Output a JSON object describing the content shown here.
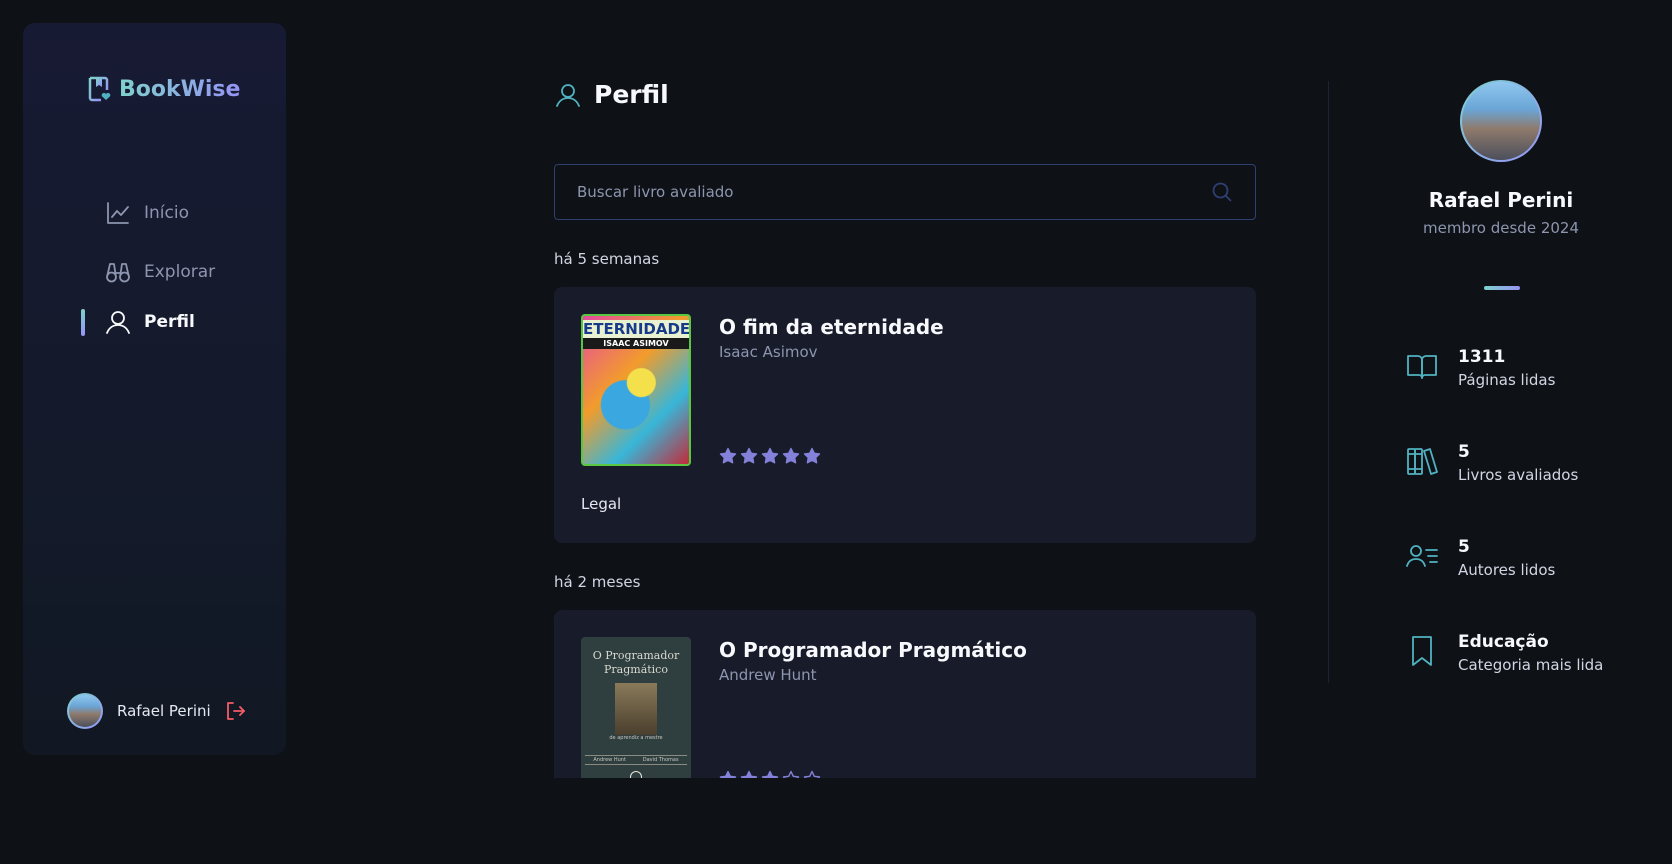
{
  "app": {
    "name": "BookWise"
  },
  "nav": {
    "items": [
      {
        "label": "Início",
        "icon": "chart-line-icon",
        "active": false
      },
      {
        "label": "Explorar",
        "icon": "binoculars-icon",
        "active": false
      },
      {
        "label": "Perfil",
        "icon": "user-icon",
        "active": true
      }
    ]
  },
  "sidebar_user": {
    "name": "Rafael Perini",
    "logout_icon": "sign-out-icon"
  },
  "page": {
    "title": "Perfil",
    "search_placeholder": "Buscar livro avaliado"
  },
  "reviews": [
    {
      "date": "há 5 semanas",
      "title": "O fim da eternidade",
      "author": "Isaac Asimov",
      "rating": 5,
      "max_rating": 5,
      "text": "Legal",
      "cover_text": "ETERNIDADE",
      "cover_subtext": "ISAAC ASIMOV"
    },
    {
      "date": "há 2 meses",
      "title": "O Programador Pragmático",
      "author": "Andrew Hunt",
      "rating": 3,
      "max_rating": 5,
      "text": "",
      "cover_text": "O Programador Pragmático",
      "cover_subtext": "de aprendiz a mestre",
      "cover_authors": [
        "Andrew Hunt",
        "David Thomas"
      ]
    }
  ],
  "profile": {
    "name": "Rafael Perini",
    "member_since": "membro desde 2024",
    "stats": [
      {
        "value": "1311",
        "label": "Páginas lidas",
        "icon": "book-open-icon"
      },
      {
        "value": "5",
        "label": "Livros avaliados",
        "icon": "books-icon"
      },
      {
        "value": "5",
        "label": "Autores lidos",
        "icon": "user-list-icon"
      },
      {
        "value": "Educação",
        "label": "Categoria mais lida",
        "icon": "bookmark-icon"
      }
    ]
  },
  "colors": {
    "background": "#0e1116",
    "card": "#181c2a",
    "accent_teal": "#50b2c0",
    "accent_purple": "#8381d9",
    "logout_red": "#f75a68"
  }
}
